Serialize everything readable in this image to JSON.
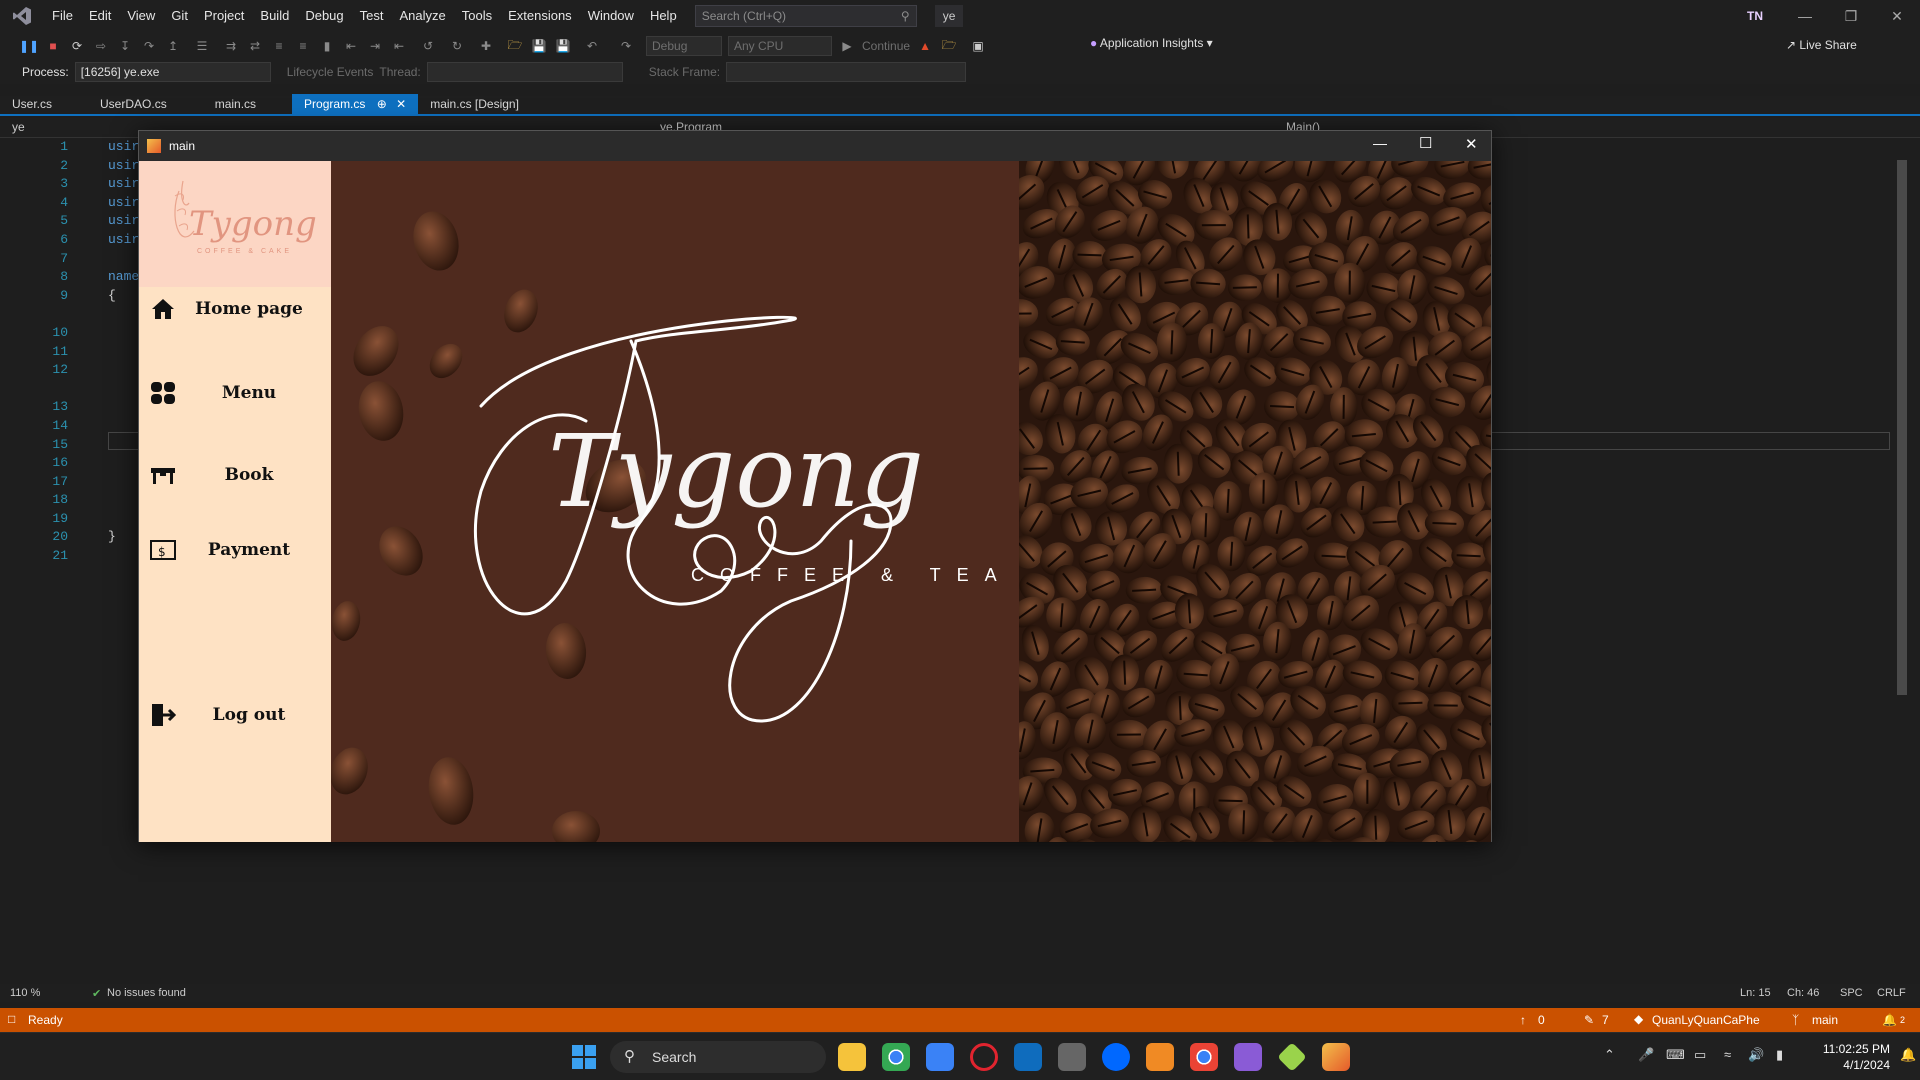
{
  "menubar": {
    "items": [
      "File",
      "Edit",
      "View",
      "Git",
      "Project",
      "Build",
      "Debug",
      "Test",
      "Analyze",
      "Tools",
      "Extensions",
      "Window",
      "Help"
    ],
    "search_placeholder": "Search (Ctrl+Q)",
    "solution_name": "ye",
    "account_initials": "TN"
  },
  "toolbar": {
    "config": "Debug",
    "platform": "Any CPU",
    "continue_label": "Continue",
    "app_insights": "Application Insights",
    "live_share": "Live Share"
  },
  "debugbar": {
    "process_label": "Process:",
    "process_value": "[16256] ye.exe",
    "lifecycle": "Lifecycle Events",
    "thread_label": "Thread:",
    "stack_frame_label": "Stack Frame:"
  },
  "tabs": [
    {
      "label": "User.cs"
    },
    {
      "label": "UserDAO.cs"
    },
    {
      "label": "main.cs"
    },
    {
      "label": "Program.cs",
      "active": true
    },
    {
      "label": "main.cs [Design]"
    }
  ],
  "navbar": {
    "project": "ye",
    "class": "ye.Program",
    "member": "Main()"
  },
  "editor": {
    "line_numbers": [
      "1",
      "2",
      "3",
      "4",
      "5",
      "6",
      "7",
      "8",
      "9",
      "",
      "10",
      "11",
      "12",
      "",
      "13",
      "14",
      "15",
      "16",
      "17",
      "18",
      "19",
      "20",
      "21"
    ],
    "visible_code": [
      "usir",
      "usir",
      "usir",
      "usir",
      "usir",
      "usir",
      "",
      "name",
      "{",
      "",
      "",
      "",
      "",
      "",
      "",
      "",
      "",
      "",
      "",
      "",
      "",
      "}",
      ""
    ]
  },
  "editor_status": {
    "zoom": "110 %",
    "issues": "No issues found",
    "line": "Ln: 15",
    "col": "Ch: 46",
    "spacing": "SPC",
    "eol": "CRLF"
  },
  "statusbar": {
    "state": "Ready",
    "up_count": "0",
    "pencil_count": "7",
    "repo": "QuanLyQuanCaPhe",
    "branch": "main",
    "notifications": "2"
  },
  "taskbar": {
    "search": "Search",
    "time": "11:02:25 PM",
    "date": "4/1/2024"
  },
  "form": {
    "title": "main",
    "logo_text": "Tygong",
    "logo_subtext": "COFFEE & CAKE",
    "hero_title": "Tygong",
    "hero_subtitle": "COFFEE & TEA",
    "nav": [
      {
        "label": "Home page",
        "icon": "home-icon"
      },
      {
        "label": "Menu",
        "icon": "grid-icon"
      },
      {
        "label": "Book",
        "icon": "table-icon"
      },
      {
        "label": "Payment",
        "icon": "dollar-icon"
      },
      {
        "label": "Log out",
        "icon": "logout-icon"
      }
    ],
    "colors": {
      "sidebar": "#fee2c4",
      "hero": "#4f2a1e",
      "beans": "#2a160d"
    }
  }
}
